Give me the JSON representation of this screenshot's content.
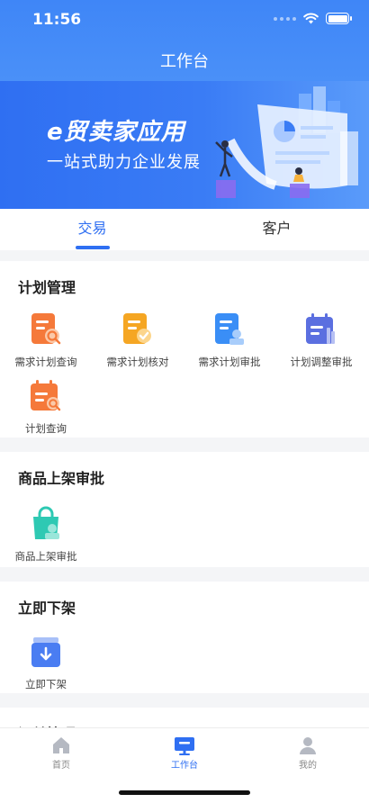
{
  "status": {
    "time": "11:56"
  },
  "header": {
    "title": "工作台"
  },
  "banner": {
    "title": "e贸卖家应用",
    "subtitle": "一站式助力企业发展"
  },
  "tabs": [
    {
      "label": "交易",
      "active": true
    },
    {
      "label": "客户",
      "active": false
    }
  ],
  "sections": [
    {
      "title": "计划管理",
      "items": [
        {
          "label": "需求计划查询",
          "icon": "plan-search-icon",
          "color": "#f5793a"
        },
        {
          "label": "需求计划核对",
          "icon": "plan-check-icon",
          "color": "#f5a623"
        },
        {
          "label": "需求计划审批",
          "icon": "plan-approve-icon",
          "color": "#3a8ef6"
        },
        {
          "label": "计划调整审批",
          "icon": "plan-adjust-icon",
          "color": "#5b6fe0"
        },
        {
          "label": "计划查询",
          "icon": "calendar-search-icon",
          "color": "#f5793a"
        }
      ]
    },
    {
      "title": "商品上架审批",
      "items": [
        {
          "label": "商品上架审批",
          "icon": "shopping-bag-icon",
          "color": "#2ec9b3"
        }
      ]
    },
    {
      "title": "立即下架",
      "items": [
        {
          "label": "立即下架",
          "icon": "inbox-down-icon",
          "color": "#4a7df2"
        }
      ]
    },
    {
      "title": "订单管理",
      "items": []
    }
  ],
  "tabbar": [
    {
      "label": "首页",
      "icon": "home-icon",
      "active": false
    },
    {
      "label": "工作台",
      "icon": "workbench-icon",
      "active": true
    },
    {
      "label": "我的",
      "icon": "person-icon",
      "active": false
    }
  ]
}
